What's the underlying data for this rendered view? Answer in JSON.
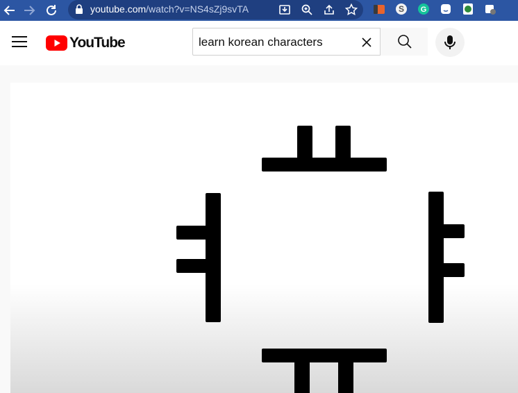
{
  "browser": {
    "url_domain": "youtube.com",
    "url_path": "/watch?v=NS4sZj9svTA",
    "icons": {
      "back": "arrow-left-icon",
      "forward": "arrow-right-icon",
      "reload": "reload-icon",
      "lock": "lock-icon",
      "install": "install-icon",
      "zoom": "zoom-icon",
      "share": "share-icon",
      "bookmark": "star-icon"
    },
    "extensions": [
      "extension-icon-orange",
      "extension-icon-s",
      "grammarly-icon",
      "extension-icon-face",
      "extension-icon-green",
      "extension-icon-gear"
    ]
  },
  "youtube": {
    "logo_text": "YouTube",
    "search_value": "learn korean characters",
    "colors": {
      "brand_red": "#ff0000"
    }
  },
  "player": {
    "content": "hangul-vowel-strokes"
  }
}
